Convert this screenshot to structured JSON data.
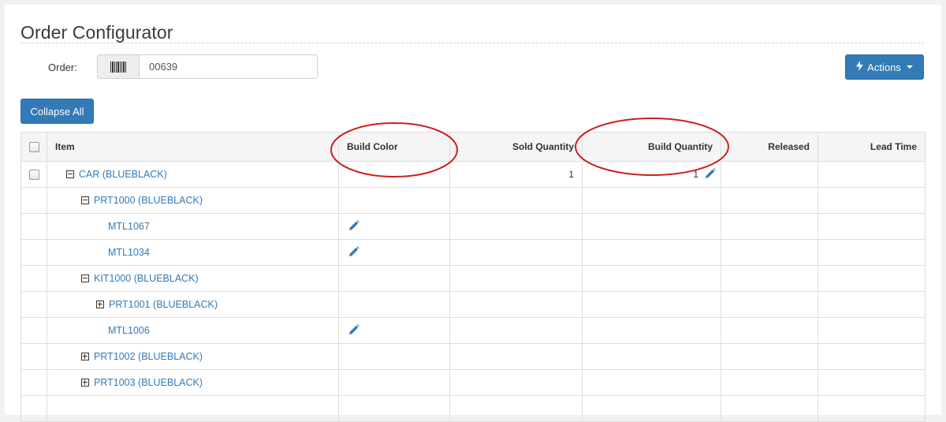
{
  "header": {
    "title": "Order Configurator"
  },
  "order": {
    "label": "Order:",
    "value": "00639",
    "barcode_icon": "barcode-icon"
  },
  "toolbar": {
    "actions_label": "Actions",
    "actions_icon": "bolt-icon",
    "collapse_all_label": "Collapse All"
  },
  "table": {
    "columns": [
      "Item",
      "Build Color",
      "Sold Quantity",
      "Build Quantity",
      "Released",
      "Lead Time"
    ],
    "rows": [
      {
        "item": "CAR (BLUEBLACK)",
        "toggle": "minus",
        "sold_qty": "1",
        "build_qty": "1"
      },
      {
        "item": "PRT1000 (BLUEBLACK)",
        "toggle": "minus"
      },
      {
        "item": "MTL1067",
        "color_edit": true
      },
      {
        "item": "MTL1034",
        "color_edit": true
      },
      {
        "item": "KIT1000 (BLUEBLACK)",
        "toggle": "minus"
      },
      {
        "item": "PRT1001 (BLUEBLACK)",
        "toggle": "plus"
      },
      {
        "item": "MTL1006",
        "color_edit": true
      },
      {
        "item": "PRT1002 (BLUEBLACK)",
        "toggle": "plus"
      },
      {
        "item": "PRT1003 (BLUEBLACK)",
        "toggle": "plus"
      }
    ]
  },
  "colors": {
    "accent": "#337ab7",
    "annotation": "#cc1f1f"
  }
}
